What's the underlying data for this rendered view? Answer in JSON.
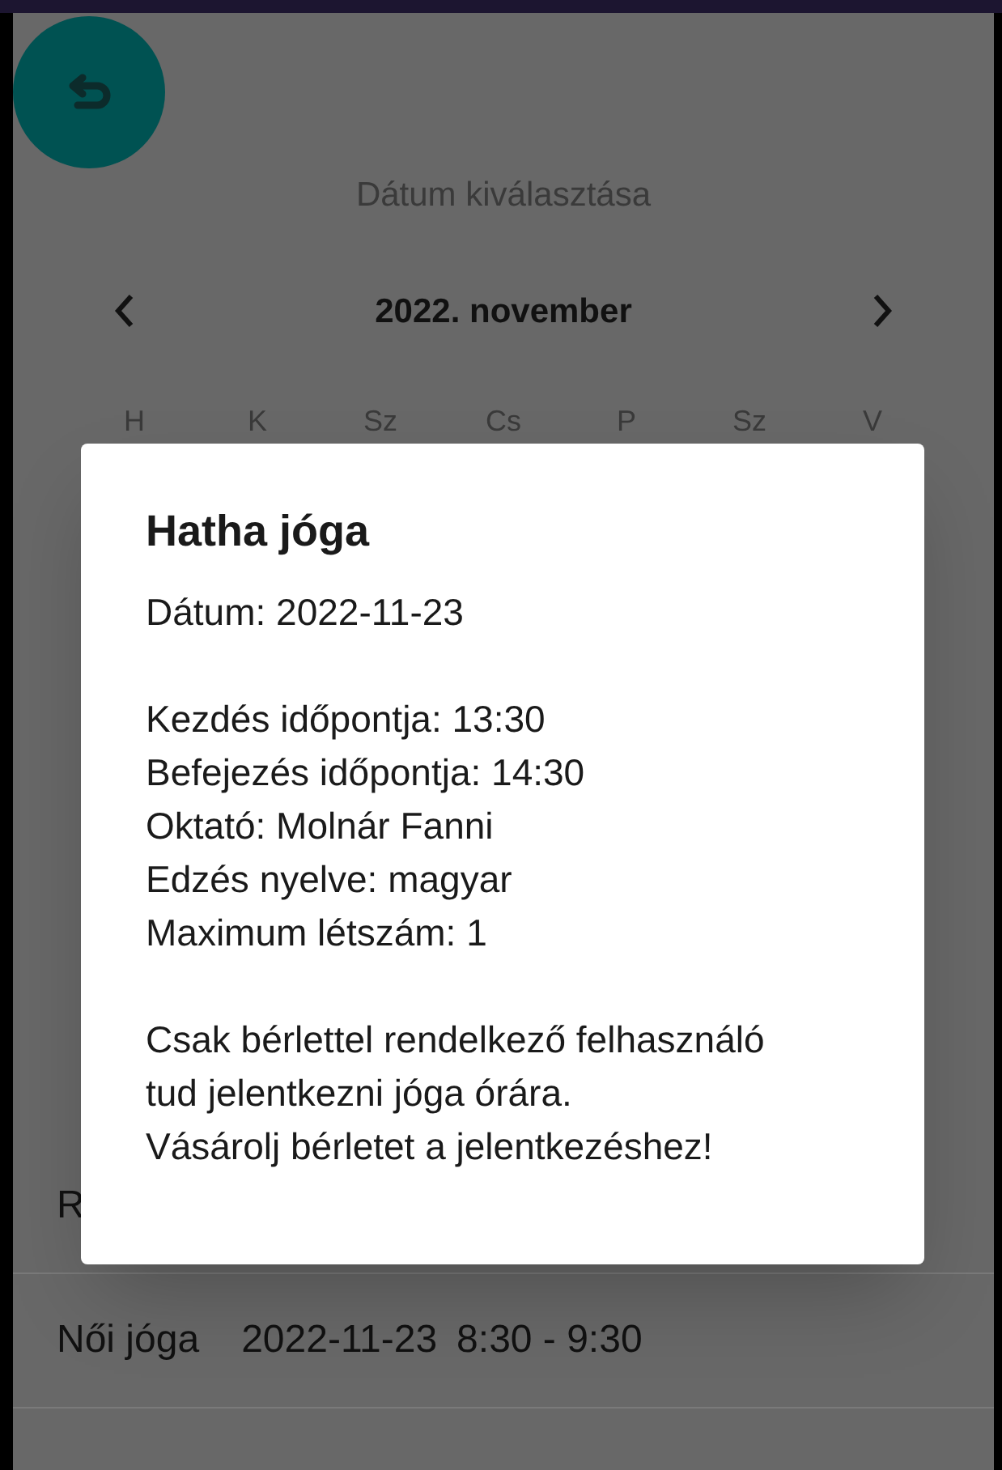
{
  "screen": {
    "title": "Dátum kiválasztása",
    "month": "2022. november",
    "weekdays": [
      "H",
      "K",
      "Sz",
      "Cs",
      "P",
      "Sz",
      "V"
    ]
  },
  "classes": [
    {
      "name": "R"
    },
    {
      "name": "Női jóga",
      "date": "2022-11-23",
      "time": "8:30 - 9:30"
    }
  ],
  "dialog": {
    "title": "Hatha jóga",
    "date_line": "Dátum: 2022-11-23",
    "details": [
      "Kezdés időpontja: 13:30",
      "Befejezés időpontja: 14:30",
      "Oktató: Molnár Fanni",
      "Edzés nyelve: magyar",
      "Maximum létszám: 1"
    ],
    "message": [
      "Csak bérlettel rendelkező felhasználó tud jelentkezni jóga órára.",
      "Vásárolj bérletet a jelentkezéshez!"
    ]
  }
}
